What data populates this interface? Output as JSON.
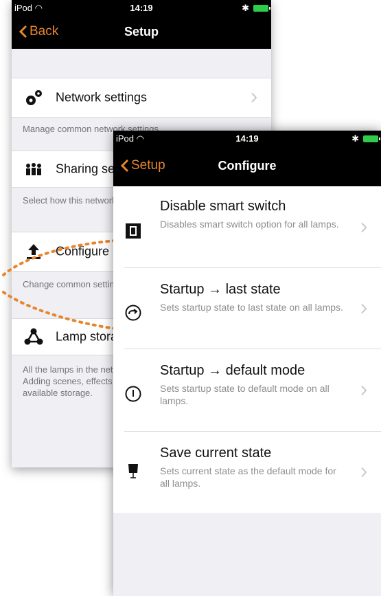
{
  "colors": {
    "accent": "#e8852d",
    "bar": "#000000",
    "battery": "#2fcc4a",
    "background": "#efeff4"
  },
  "back_screen": {
    "status": {
      "carrier": "iPod",
      "time": "14:19"
    },
    "nav": {
      "back_label": "Back",
      "title": "Setup"
    },
    "items": [
      {
        "icon": "gears-icon",
        "label": "Network settings",
        "footer": "Manage common network settings"
      },
      {
        "icon": "people-icon",
        "label": "Sharing settings",
        "footer": "Select how this network is shared with other mobile devices"
      },
      {
        "icon": "upload-icon",
        "label": "Configure lamps",
        "footer": "Change common settings for all lamps in network."
      },
      {
        "icon": "network-nodes-icon",
        "label": "Lamp storage",
        "footer": "All the lamps in the network share the same configuration. Adding scenes, effects and timers to network will consume available storage."
      }
    ]
  },
  "front_screen": {
    "status": {
      "carrier": "iPod",
      "time": "14:19"
    },
    "nav": {
      "back_label": "Setup",
      "title": "Configure"
    },
    "options": [
      {
        "icon": "smart-switch-icon",
        "title": "Disable smart switch",
        "subtitle": "Disables smart switch option for all lamps."
      },
      {
        "icon": "arrow-circle-icon",
        "title": "Startup → last state",
        "subtitle": "Sets startup state to last state on all lamps."
      },
      {
        "icon": "power-icon",
        "title": "Startup → default mode",
        "subtitle": "Sets startup state to default mode on all lamps."
      },
      {
        "icon": "lamp-icon",
        "title": "Save current state",
        "subtitle": "Sets current state as the default mode for all lamps."
      }
    ]
  }
}
